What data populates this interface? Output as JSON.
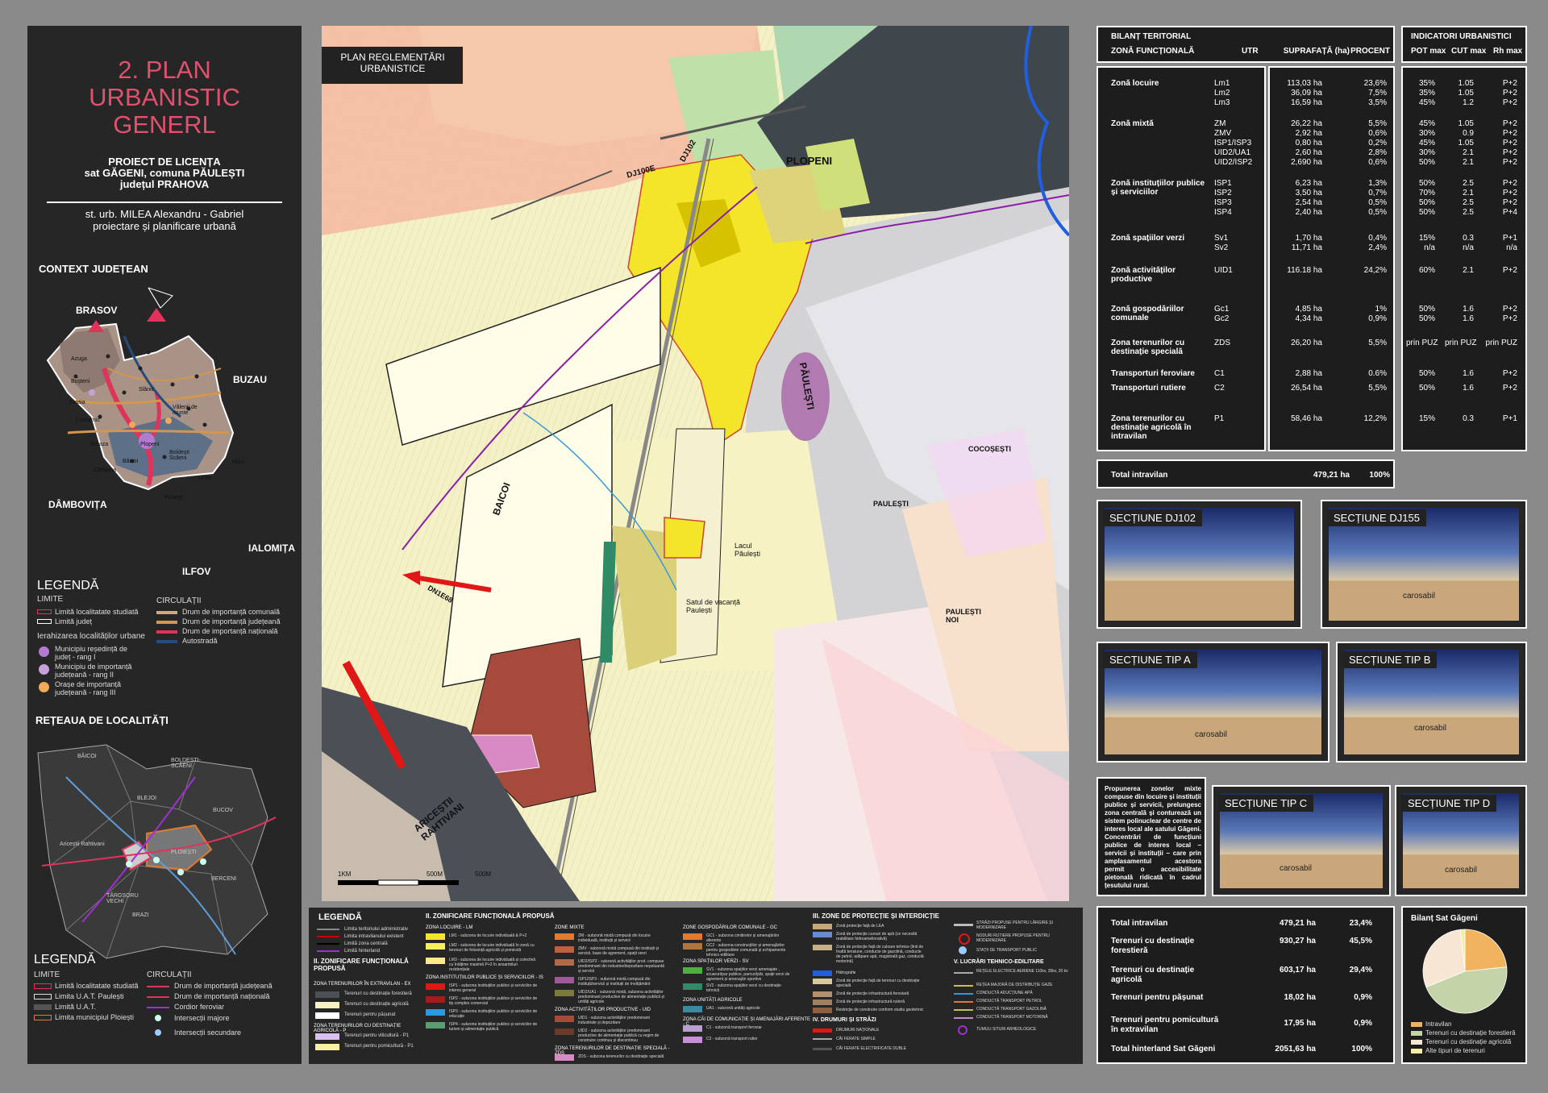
{
  "left_panel": {
    "title_lines": [
      "2. PLAN",
      "URBANISTIC",
      "GENERL"
    ],
    "subtitle_lines": [
      "PROIECT DE LICENȚA",
      "sat GĂGENI, comuna PĂULEȘTI",
      "județul PRAHOVA"
    ],
    "author_lines": [
      "st. urb. MILEA Alexandru - Gabriel",
      "proiectare și planificare urbană"
    ],
    "context_title": "CONTEXT JUDEȚEAN",
    "neighbors": {
      "north": "BRASOV",
      "east": "BUZAU",
      "west": "DÂMBOVIȚA",
      "south": "ILFOV",
      "southeast": "IALOMIȚA"
    },
    "towns": [
      "Azuga",
      "Bușteni",
      "Sinaia",
      "Comarnic",
      "Breaza",
      "Câmpina",
      "Băicoi",
      "Ploiești",
      "Slănic",
      "Vălenii de munte",
      "Plopeni",
      "Boldești Scăeni",
      "Urlați",
      "Mizil"
    ],
    "legend1": {
      "title": "LEGENDĂ",
      "limits_title": "LIMITE",
      "limits": [
        "Limită localitatate studiată",
        "Limită județ"
      ],
      "hierarchy_title": "Ierahizarea localităților urbane",
      "hierarchy": [
        "Municipiu reședință de județ - rang I",
        "Municipiu de importanță județeană - rang II",
        "Orașe de importanță județeană - rang III"
      ],
      "circ_title": "CIRCULAȚII",
      "circ": [
        "Drum de importanță comunală",
        "Drum de importanță județeană",
        "Drum de importanță națională",
        "Autostradă"
      ]
    },
    "network_title": "REȚEAUA DE LOCALITĂȚI",
    "network_places": [
      "BĂICOI",
      "BOLDEȘTI-SCĂENI",
      "BLEJOI",
      "BUCOV",
      "Ariceștii Rahtivani",
      "PLOIEȘTI",
      "BERCENI",
      "TÂRGȘORU VECHI",
      "BRAZI"
    ],
    "legend2": {
      "title": "LEGENDĂ",
      "limits_title": "LIMITE",
      "limits": [
        "Limită localitatate studiată",
        "Limita U.A.T. Paulești",
        "Limită U.A.T.",
        "Limita municipiul Ploiești"
      ],
      "circ_title": "CIRCULAȚII",
      "circ": [
        "Drum de importanță județeană",
        "Drum de importanță națională",
        "Cordior feroviar",
        "Intersecții majore",
        "Intersecții secundare"
      ]
    }
  },
  "map": {
    "title": "PLAN REGLEMENTĂRI URBANISTICE",
    "labels": {
      "plopeni": "PLOPENI",
      "paulesti_road": "PĂULEȘTI",
      "baicoi": "BAICOI",
      "cocosesti": "COCOȘEȘTI",
      "paulesti": "PAULEȘTI",
      "paulesti_noi": "PAULEȘTI NOI",
      "lacul": "Lacul Păulești",
      "satul": "Satul de vacanță Paulești",
      "aricestii": "ARICEȘTII RAHTIVANI",
      "dj102": "DJ102",
      "dj100e": "DJ100E",
      "dn1e68": "DN1E68"
    },
    "scale": [
      "1KM",
      "500M",
      "500M"
    ]
  },
  "bilant": {
    "title": "BILANȚ TERITORIAL",
    "headers": [
      "ZONĂ FUNCȚIONALĂ",
      "UTR",
      "SUPRAFAȚĂ (ha)",
      "PROCENT"
    ],
    "rows": [
      {
        "zone": "Zonă locuire",
        "utr": [
          "Lm1",
          "Lm2",
          "Lm3"
        ],
        "sup": [
          "113,03 ha",
          "36,09 ha",
          "16,59 ha"
        ],
        "pct": [
          "23,6%",
          "7,5%",
          "3,5%"
        ]
      },
      {
        "zone": "Zonă mixtă",
        "utr": [
          "ZM",
          "ZMV",
          "ISP1/ISP3",
          "UID2/UA1",
          "UID2/ISP2"
        ],
        "sup": [
          "26,22 ha",
          "2,92 ha",
          "0,80 ha",
          "2,60 ha",
          "2,690 ha"
        ],
        "pct": [
          "5,5%",
          "0,6%",
          "0,2%",
          "2,8%",
          "0,6%"
        ]
      },
      {
        "zone": "Zonă instituțiilor publice și serviciilor",
        "utr": [
          "ISP1",
          "ISP2",
          "ISP3",
          "ISP4"
        ],
        "sup": [
          "6,23 ha",
          "3,50 ha",
          "2,54 ha",
          "2,40 ha"
        ],
        "pct": [
          "1,3%",
          "0,7%",
          "0,5%",
          "0,5%"
        ]
      },
      {
        "zone": "Zonă spațiilor verzi",
        "utr": [
          "Sv1",
          "Sv2"
        ],
        "sup": [
          "1,70 ha",
          "11,71 ha"
        ],
        "pct": [
          "0,4%",
          "2,4%"
        ]
      },
      {
        "zone": "Zonă activităților productive",
        "utr": [
          "UID1"
        ],
        "sup": [
          "116.18 ha"
        ],
        "pct": [
          "24,2%"
        ]
      },
      {
        "zone": "Zonă gospodăriilor comunale",
        "utr": [
          "Gc1",
          "Gc2"
        ],
        "sup": [
          "4,85 ha",
          "4,34 ha"
        ],
        "pct": [
          "1%",
          "0,9%"
        ]
      },
      {
        "zone": "Zona terenurilor cu destinație specială",
        "utr": [
          "ZDS"
        ],
        "sup": [
          "26,20 ha"
        ],
        "pct": [
          "5,5%"
        ]
      },
      {
        "zone": "Transporturi feroviare",
        "utr": [
          "C1"
        ],
        "sup": [
          "2,88 ha"
        ],
        "pct": [
          "0.6%"
        ]
      },
      {
        "zone": "Transporturi rutiere",
        "utr": [
          "C2"
        ],
        "sup": [
          "26,54 ha"
        ],
        "pct": [
          "5,5%"
        ]
      },
      {
        "zone": "Zona terenurilor cu destinație agricolă în intravilan",
        "utr": [
          "P1"
        ],
        "sup": [
          "58,46 ha"
        ],
        "pct": [
          "12,2%"
        ]
      }
    ],
    "total": {
      "label": "Total intravilan",
      "sup": "479,21 ha",
      "pct": "100%"
    }
  },
  "indicatori": {
    "title": "INDICATORI URBANISTICI",
    "headers": [
      "POT max",
      "CUT max",
      "Rh max"
    ],
    "rows": [
      [
        [
          "35%",
          "1.05",
          "P+2"
        ],
        [
          "35%",
          "1.05",
          "P+2"
        ],
        [
          "45%",
          "1.2",
          "P+2"
        ]
      ],
      [
        [
          "45%",
          "1.05",
          "P+2"
        ],
        [
          "30%",
          "0.9",
          "P+2"
        ],
        [
          "45%",
          "1.05",
          "P+2"
        ],
        [
          "30%",
          "2.1",
          "P+2"
        ],
        [
          "50%",
          "2.1",
          "P+2"
        ]
      ],
      [
        [
          "50%",
          "2.5",
          "P+2"
        ],
        [
          "70%",
          "2.1",
          "P+2"
        ],
        [
          "50%",
          "2.5",
          "P+2"
        ],
        [
          "50%",
          "2.5",
          "P+4"
        ]
      ],
      [
        [
          "15%",
          "0.3",
          "P+1"
        ],
        [
          "n/a",
          "n/a",
          "n/a"
        ]
      ],
      [
        [
          "60%",
          "2.1",
          "P+2"
        ]
      ],
      [
        [
          "50%",
          "1.6",
          "P+2"
        ],
        [
          "50%",
          "1.6",
          "P+2"
        ]
      ],
      [
        [
          "prin PUZ",
          "prin PUZ",
          "prin PUZ"
        ]
      ],
      [
        [
          "50%",
          "1.6",
          "P+2"
        ]
      ],
      [
        [
          "50%",
          "1.6",
          "P+2"
        ]
      ],
      [
        [
          "15%",
          "0.3",
          "P+1"
        ]
      ]
    ]
  },
  "sections": {
    "dj102": "SECȚIUNE DJ102",
    "dj155": "SECȚIUNE DJ155",
    "a": "SECȚIUNE TIP A",
    "b": "SECȚIUNE TIP B",
    "c": "SECȚIUNE TIP C",
    "d": "SECȚIUNE TIP D",
    "carosabil": "carosabil"
  },
  "proposal_text": "Propunerea zonelor mixte compuse din locuire și instituții publice și servicii, prelungesc zona centrală și conturează un sistem polinuclear de centre de interes local ale satului Găgeni. Concentrări de funcțiuni publice de interes local – servicii și instituții – care prin amplasamentul acestora permit o accesibilitate pietonală ridicată în cadrul țesutului rural.",
  "hinterland": {
    "rows": [
      {
        "label": "Total intravilan",
        "sup": "479,21 ha",
        "pct": "23,4%"
      },
      {
        "label": "Terenuri cu destinație forestieră",
        "sup": "930,27 ha",
        "pct": "45,5%"
      },
      {
        "label": "Terenuri cu destinație agricolă",
        "sup": "603,17 ha",
        "pct": "29,4%"
      },
      {
        "label": "Terenuri pentru pășunat",
        "sup": "18,02 ha",
        "pct": "0,9%"
      },
      {
        "label": "Terenuri pentru pomicultură în extravilan",
        "sup": "17,95 ha",
        "pct": "0,9%"
      }
    ],
    "total": {
      "label": "Total hinterland Sat Găgeni",
      "sup": "2051,63 ha",
      "pct": "100%"
    }
  },
  "chart_data": {
    "type": "pie",
    "title": "Bilanț Sat Găgeni",
    "categories": [
      "Intravilan",
      "Terenuri cu destinație forestieră",
      "Terenuri cu destinație agricolă",
      "Alte tipuri de terenuri"
    ],
    "values": [
      23.4,
      45.5,
      29.4,
      1.8
    ],
    "colors": [
      "#f2b35f",
      "#c4d3a8",
      "#f7e6d3",
      "#f3eea6"
    ],
    "legend_position": "bottom"
  },
  "bottom_legend": {
    "title": "LEGENDĂ",
    "limits": [
      "Limita teritoriului administrativ",
      "Limita intravilanului existent",
      "Limită zona centrală",
      "Limită hinterland"
    ],
    "s2_title": "II. ZONIFICARE FUNCȚIONALĂ PROPUSĂ",
    "extravilan_title": "ZONA TERENURILOR ÎN EXTRAVILAN - EX",
    "extravilan": [
      "Terenuri cu destinație forestieră",
      "Terenuri cu destinație agricolă",
      "Terenuri pentru pășunat"
    ],
    "agri_title": "ZONA TERENURILOR CU DESTINAȚIE AGRICOLĂ - P",
    "agri": [
      "Terenuri pentru viticultură - P1",
      "Terenuri pentru pomicultură - P1"
    ],
    "col2_title": "II. ZONIFICARE FUNCȚIONALĂ PROPUSĂ",
    "locuire_title": "ZONA LOCUIRE - LM",
    "locuire": [
      "LM1 - subzona de locuire individuală & P+2",
      "LM2 - subzona de locuire individuală în zonă cu terenuri de folosință agricolă și pomicolă",
      "LM3 - subzona de locuire individuală și colectivă cu înălțime maximă P+2 în ansambluri rezidențiale"
    ],
    "inst_title": "ZONA INSTITUȚIILOR PUBLICE ȘI SERVICIILOR - IS",
    "inst": [
      "ISP1 - subzona instituțiilor publice și serviciilor de interes general",
      "ISP2 - subzona instituțiilor publice și serviciilor de tip complex comercial",
      "ISP3 - subzona instituțiilor publice și serviciilor de educație",
      "ISP4 - subzona instituțiilor publice și serviciilor de turism și alimentație publică"
    ],
    "mixte_title": "ZONE MIXTE",
    "mixte": [
      "ZM - subzonă mixtă compusă din locuire individuală, instituții și servicii",
      "ZMV - subzonă mixtă compusă din instituții și servicii, baze de agrement, spații verzi",
      "UID2/ISP2 - subzonă activităților prod. compuse predominant din industrie/depozitare nepoluantă și servicii",
      "ISP1/ISP3 - subzonă mixtă compusă din instituții/servicii și instituții de învățământ",
      "UID2/UA1 - subzonă mixtă, subzona activităților predominant productive de alimentație publică și unități agricole"
    ],
    "activ_title": "ZONA ACTIVITĂȚILOR PRODUCTIVE - UID",
    "activ": [
      "UID1 - subzona activităților predominant industriale și depozitare",
      "UID2 - subzona activităților predominant productive de alimentație publică cu regim de construire continuu și discontinuu"
    ],
    "ds_title": "ZONA TERENURILOR DE DESTINAȚIE SPECIALĂ - ZDS",
    "ds": [
      "ZDS - subzona terenurilor cu destinație specială"
    ],
    "gc_title": "ZONE GOSPODĂRILOR COMUNALE - GC",
    "gc": [
      "GC1 - subzona cimitirelor și amenajărilor aferente",
      "GC2 - subzona construcțiilor și amenajărilor pentru gospodărie comunală și echipamente tehnico edilitare"
    ],
    "sv_title": "ZONA SPAȚIILOR VERZI - SV",
    "sv": [
      "SV1 - subzona spațiilor verzi amenajate , scuaruri/par publice, parcuri/păr, spații verzi de agrement și amenajări sportive",
      "SV2 - subzona spațiilor verzi cu destinație tehnică"
    ],
    "ua_title": "ZONA UNITĂȚI AGRICOLE",
    "ua": [
      "UA1 - subzonă unități agricole"
    ],
    "cai_title": "ZONA CĂI DE COMUNICAȚIE ȘI AMENAJĂRI AFERENTE - C",
    "cai": [
      "C1 - subzonă transport feroviar",
      "C2 - subzonă transport rutier"
    ],
    "prot_title": "III. ZONE DE PROTECȚIE ȘI INTERDICȚIE",
    "prot": [
      "Zonă protecție față de LEA",
      "Zonă de protecție cursuri de apă (ce necesită reabilitare hidroameliorativă)",
      "Zonă de protecție față de culoare tehnice (linii de înaltă tensiune, conducte de gazolină, conducte de petrol, adăpare apă, magistrală gaz, conductă motorină)",
      "Hidrografie",
      "Zonă de protecție față de terenuri cu destinație specială",
      "Zonă de protecție infrastructură feroviară",
      "Zonă de protecție infrastructură rutieră",
      "Restricție de construire conform studiu geotehnic"
    ],
    "drum_title": "IV. DRUMURI ȘI STRĂZI",
    "drum": [
      "DRUMURI NAȚIONALE",
      "CĂI FERATE SIMPLE",
      "CĂI FERATE ELECTRIFICATE DUBLE"
    ],
    "str": [
      "STRĂZI PROPUSE PENTRU LĂRGIRE ȘI MODERNIZARE",
      "NODURI RUTIERE PROPUSE PENTRU MODERNIZARE",
      "STAȚII DE TRANSPORT PUBLIC"
    ],
    "edil_title": "V. LUCRĂRI TEHNICO-EDILITARE",
    "edil": [
      "REȚELE ELECTRICE AERIENE 110kv, 35kv, 20 kv",
      "REȚEA MAJORĂ DE DISTRIBUȚIE GAZE",
      "CONDUCTĂ ADUCȚIUNE APĂ",
      "CONDUCTĂ TRANSPORT PETROL",
      "CONDUCTĂ TRANSPORT GAZOLINĂ",
      "CONDUCTĂ TRANSPORT MOTORINĂ",
      "TUMULI SITURI ARHEOLOGICE"
    ]
  }
}
